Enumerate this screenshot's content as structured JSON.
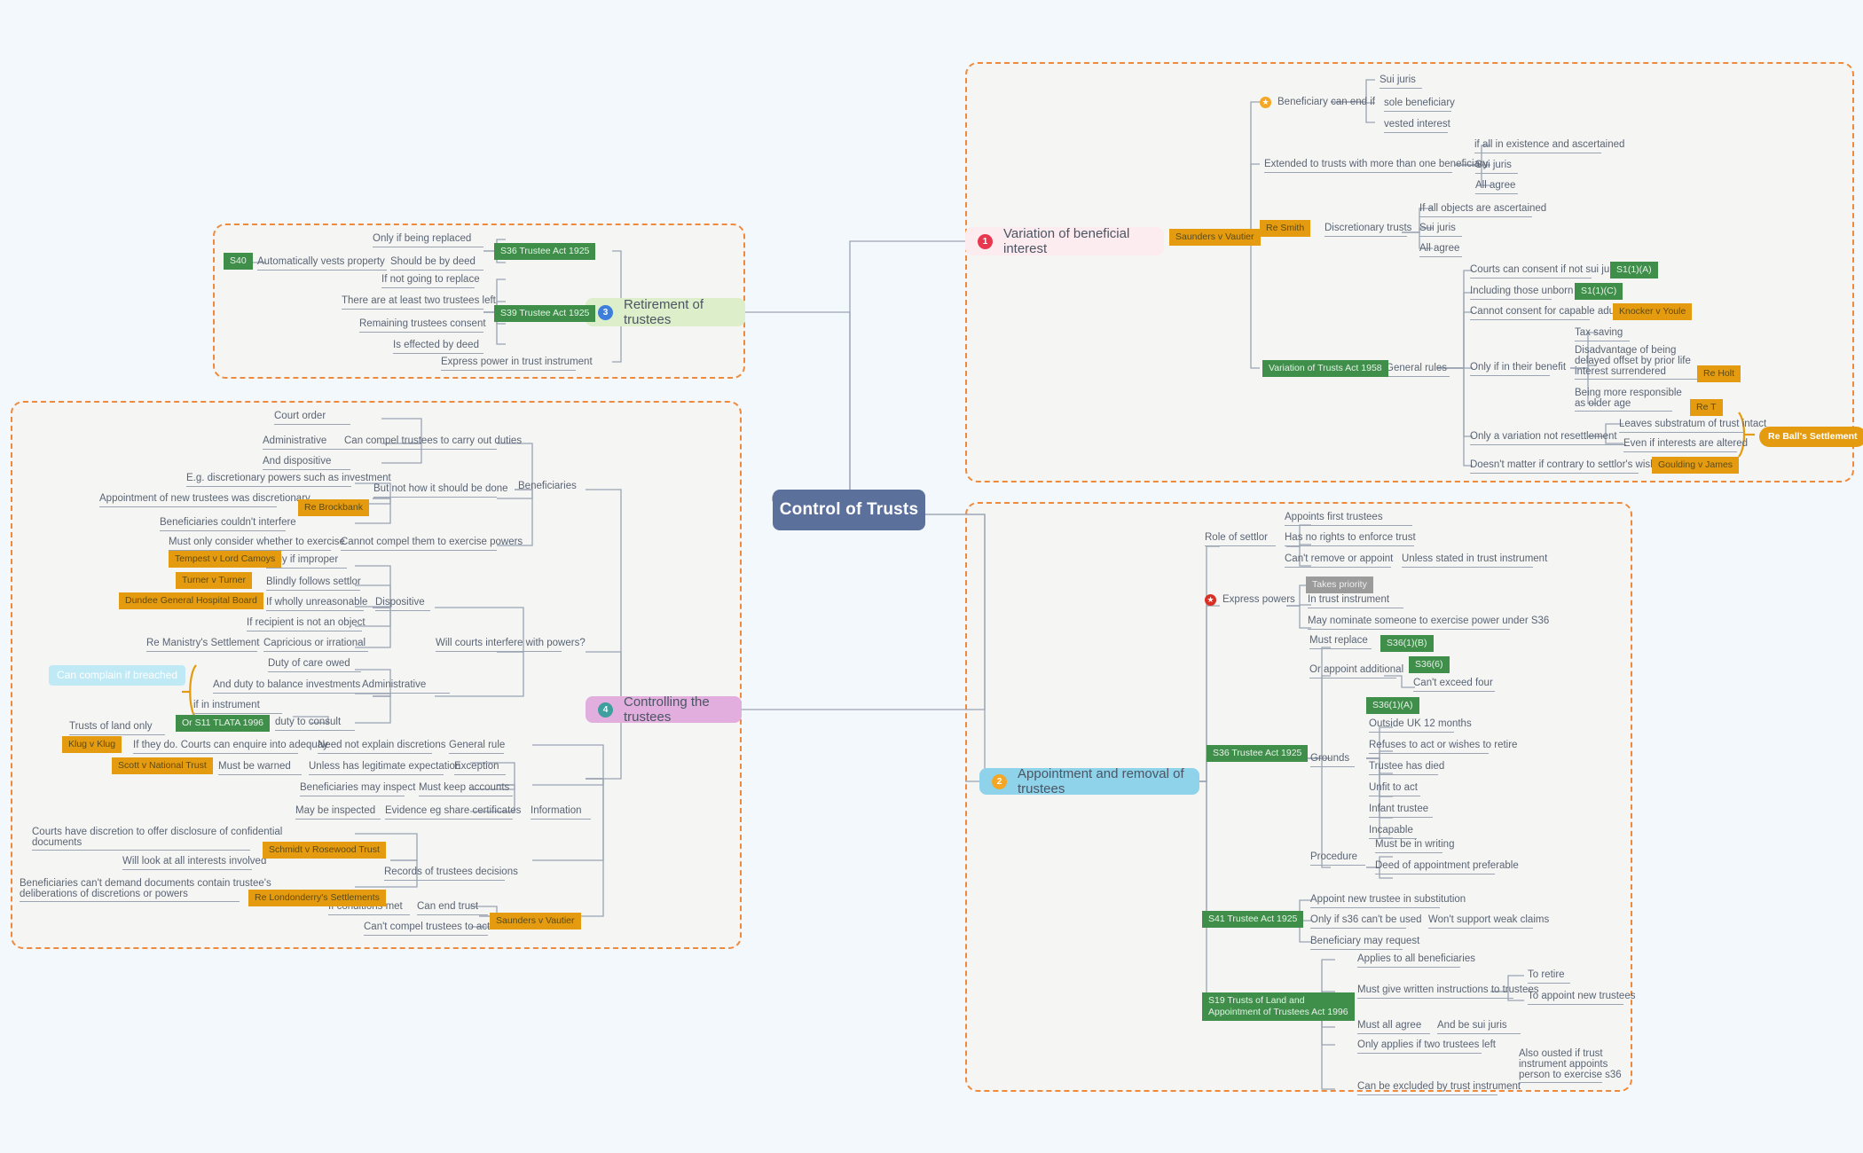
{
  "root": {
    "label": "Control of Trusts",
    "color": "#5b719b"
  },
  "groups": [
    {
      "name": "retirement-group"
    },
    {
      "name": "variation-group"
    },
    {
      "name": "controlling-group"
    },
    {
      "name": "appointment-group"
    }
  ],
  "main_topics": [
    {
      "num": "1",
      "label": "Variation of beneficial interest",
      "bg": "#fdecef",
      "badge": "#e8384f"
    },
    {
      "num": "2",
      "label": "Appointment and removal of trustees",
      "bg": "#8ed3ea",
      "badge": "#f5a623"
    },
    {
      "num": "3",
      "label": "Retirement of trustees",
      "bg": "#ddeecb",
      "badge": "#3d7ddb"
    },
    {
      "num": "4",
      "label": "Controlling the trustees",
      "bg": "#e2aede",
      "badge": "#3f9e9e"
    }
  ],
  "retirement": {
    "nodes": [
      "Only if being replaced",
      "Should be by deed",
      "Automatically vests property",
      "If not going to replace",
      "There are at least two trustees left",
      "Remaining trustees consent",
      "Is effected by deed",
      "Express power in trust instrument"
    ],
    "chips": [
      {
        "text": "S40",
        "color": "green"
      },
      {
        "text": "S36 Trustee Act 1925",
        "color": "green"
      },
      {
        "text": "S39 Trustee Act 1925",
        "color": "green"
      }
    ]
  },
  "variation": {
    "nodes": [
      "Sui juris",
      "sole beneficiary",
      "vested interest",
      "Beneficiary can end if",
      "Extended to trusts with more than one beneficiary",
      "if all in existence and ascertained",
      "Sui juris",
      "All agree",
      "Discretionary trusts",
      "If all objects are ascertained",
      "Sui juris",
      "All agree",
      "General rules",
      "Courts can consent if not sui juris",
      "Including those unborn",
      "Cannot consent for capable adult",
      "Only if in their benefit",
      "Tax saving",
      "Disadvantage of being\ndelayed offset by prior life\ninterest surrendered",
      "Being more responsible\nas older age",
      "Only a variation not resettlement",
      "Leaves substratum of trust intact",
      "Even if interests are altered",
      "Doesn't matter if contrary to settlor's wishes"
    ],
    "chips": [
      {
        "text": "Saunders v Vautier",
        "color": "orange"
      },
      {
        "text": "Re Smith",
        "color": "orange"
      },
      {
        "text": "Variation of Trusts Act 1958",
        "color": "green"
      },
      {
        "text": "S1(1)(A)",
        "color": "green"
      },
      {
        "text": "S1(1)(C)",
        "color": "green"
      },
      {
        "text": "Knocker v Youle",
        "color": "orange"
      },
      {
        "text": "Re Holt",
        "color": "orange"
      },
      {
        "text": "Re T",
        "color": "orange"
      },
      {
        "text": "Re Ball's Settlement",
        "color": "pill"
      },
      {
        "text": "Goulding v James",
        "color": "orange"
      }
    ]
  },
  "controlling": {
    "nodes": [
      "Court order",
      "Administrative",
      "And dispositive",
      "Can compel trustees to carry out duties",
      "E.g. discretionary powers such as investment",
      "Appointment of new trustees was discretionary",
      "Beneficiaries couldn't interfere",
      "But not how it should be done",
      "Beneficiaries",
      "Must only consider whether to exercise",
      "Cannot compel them to exercise powers",
      "Only if improper",
      "Blindly follows settlor",
      "If wholly unreasonable",
      "Dispositive",
      "If recipient is not an object",
      "Re Manistry's Settlement",
      "Capricious or irrational",
      "Will courts interfere with powers?",
      "Duty of care owed",
      "And duty to balance investments",
      "Administrative",
      "if in instrument",
      "duty to consult",
      "Trusts of land only",
      "If they do. Courts can enquire into adequay",
      "Need not explain discretions",
      "General rule",
      "Must be warned",
      "Unless has legitimate expectation",
      "Exception",
      "Beneficiaries may inspect",
      "Must keep accounts",
      "May be inspected",
      "Evidence eg share certificates",
      "Information",
      "Courts have discretion to offer disclosure of confidential\ndocuments",
      "Will look at all interests involved",
      "Records of trustees decisions",
      "Beneficiaries can't demand documents contain trustee's\ndeliberations of discretions or powers",
      "If conditions met",
      "Can end trust",
      "Can't compel trustees to act"
    ],
    "chips": [
      {
        "text": "Re Brockbank",
        "color": "orange"
      },
      {
        "text": "Tempest v Lord Camoys",
        "color": "orange"
      },
      {
        "text": "Turner v Turner",
        "color": "orange"
      },
      {
        "text": "Dundee General Hospital Board",
        "color": "orange"
      },
      {
        "text": "Can complain if breached",
        "color": "blue"
      },
      {
        "text": "Or S11 TLATA 1996",
        "color": "green"
      },
      {
        "text": "Klug v Klug",
        "color": "orange"
      },
      {
        "text": "Scott v National Trust",
        "color": "orange"
      },
      {
        "text": "Schmidt v Rosewood Trust",
        "color": "orange"
      },
      {
        "text": "Re Londonderry's Settlements",
        "color": "orange"
      },
      {
        "text": "Saunders v Vautier",
        "color": "orange"
      }
    ]
  },
  "appointment": {
    "nodes": [
      "Appoints first trustees",
      "Role of settlor",
      "Has no rights to enforce trust",
      "Can't remove or appoint",
      "Unless stated in trust instrument",
      "Express powers",
      "In trust instrument",
      "May nominate someone to exercise power under S36",
      "Must replace",
      "Or appoint additional",
      "Can't exceed four",
      "Grounds",
      "Outside UK 12 months",
      "Refuses to act or wishes to retire",
      "Trustee has died",
      "Unfit to act",
      "Infant trustee",
      "Incapable",
      "Procedure",
      "Must be in writing",
      "Deed of appointment preferable",
      "Appoint new trustee in substitution",
      "Only if s36 can't be used",
      "Won't support weak claims",
      "Beneficiary may request",
      "Applies to all beneficiaries",
      "Must give written instructions to trustees",
      "To retire",
      "To appoint new trustees",
      "Must all agree",
      "And be sui juris",
      "Only applies if two trustees left",
      "Can be excluded by trust instrument",
      "Also ousted if trust\ninstrument appoints\nperson to exercise s36"
    ],
    "chips": [
      {
        "text": "Takes priority",
        "color": "grey"
      },
      {
        "text": "S36 Trustee Act 1925",
        "color": "green"
      },
      {
        "text": "S36(1)(B)",
        "color": "green"
      },
      {
        "text": "S36(6)",
        "color": "green"
      },
      {
        "text": "S36(1)(A)",
        "color": "green"
      },
      {
        "text": "S41 Trustee Act 1925",
        "color": "green"
      },
      {
        "text": "S19 Trusts of Land and\nAppointment of Trustees Act 1996",
        "color": "green"
      }
    ]
  }
}
